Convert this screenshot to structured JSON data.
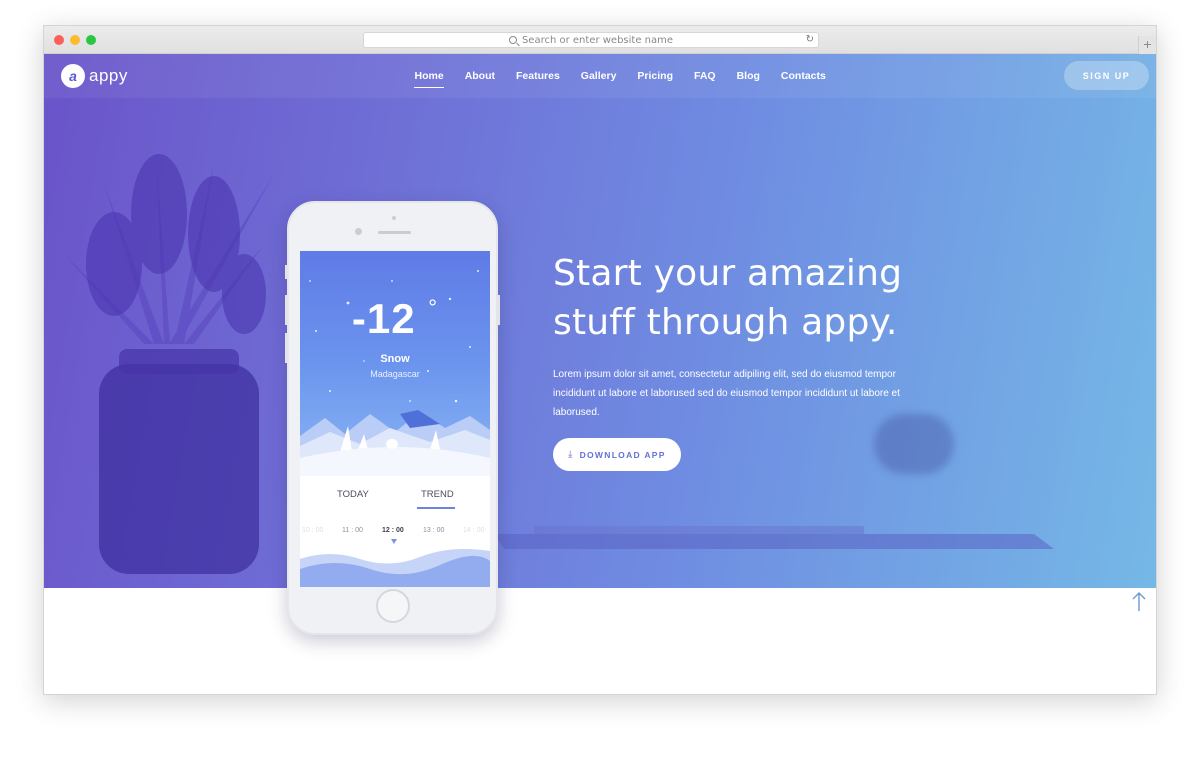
{
  "browser": {
    "url_placeholder": "Search or enter website name",
    "new_tab_label": "+",
    "reload_label": "↻"
  },
  "site": {
    "logo_letter": "a",
    "logo_text": "appy",
    "nav": [
      {
        "label": "Home",
        "active": true
      },
      {
        "label": "About"
      },
      {
        "label": "Features"
      },
      {
        "label": "Gallery"
      },
      {
        "label": "Pricing"
      },
      {
        "label": "FAQ"
      },
      {
        "label": "Blog"
      },
      {
        "label": "Contacts"
      }
    ],
    "signup_label": "SIGN UP"
  },
  "hero": {
    "headline_line1": "Start your amazing",
    "headline_line2": "stuff through appy.",
    "lead": "Lorem ipsum dolor sit amet, consectetur adipiling elit, sed do eiusmod tempor incididunt ut labore et laborused sed do eiusmod tempor incididunt ut labore et laborused.",
    "download_label": "DOWNLOAD APP",
    "download_icon": "download-icon"
  },
  "phone_app": {
    "temperature": "-12",
    "degree_symbol": "°",
    "condition": "Snow",
    "location": "Madagascar",
    "tabs": [
      "TODAY",
      "TREND"
    ],
    "active_tab": "TREND",
    "times": [
      "10 : 00",
      "11 : 00",
      "12 : 00",
      "13 : 00",
      "14 : 00"
    ],
    "selected_time": "12 : 00"
  },
  "colors": {
    "hero_start": "#6a54c9",
    "hero_end": "#75b8e6",
    "accent": "#6372d3"
  },
  "icons": {
    "scroll_top": "arrow-up-icon"
  }
}
